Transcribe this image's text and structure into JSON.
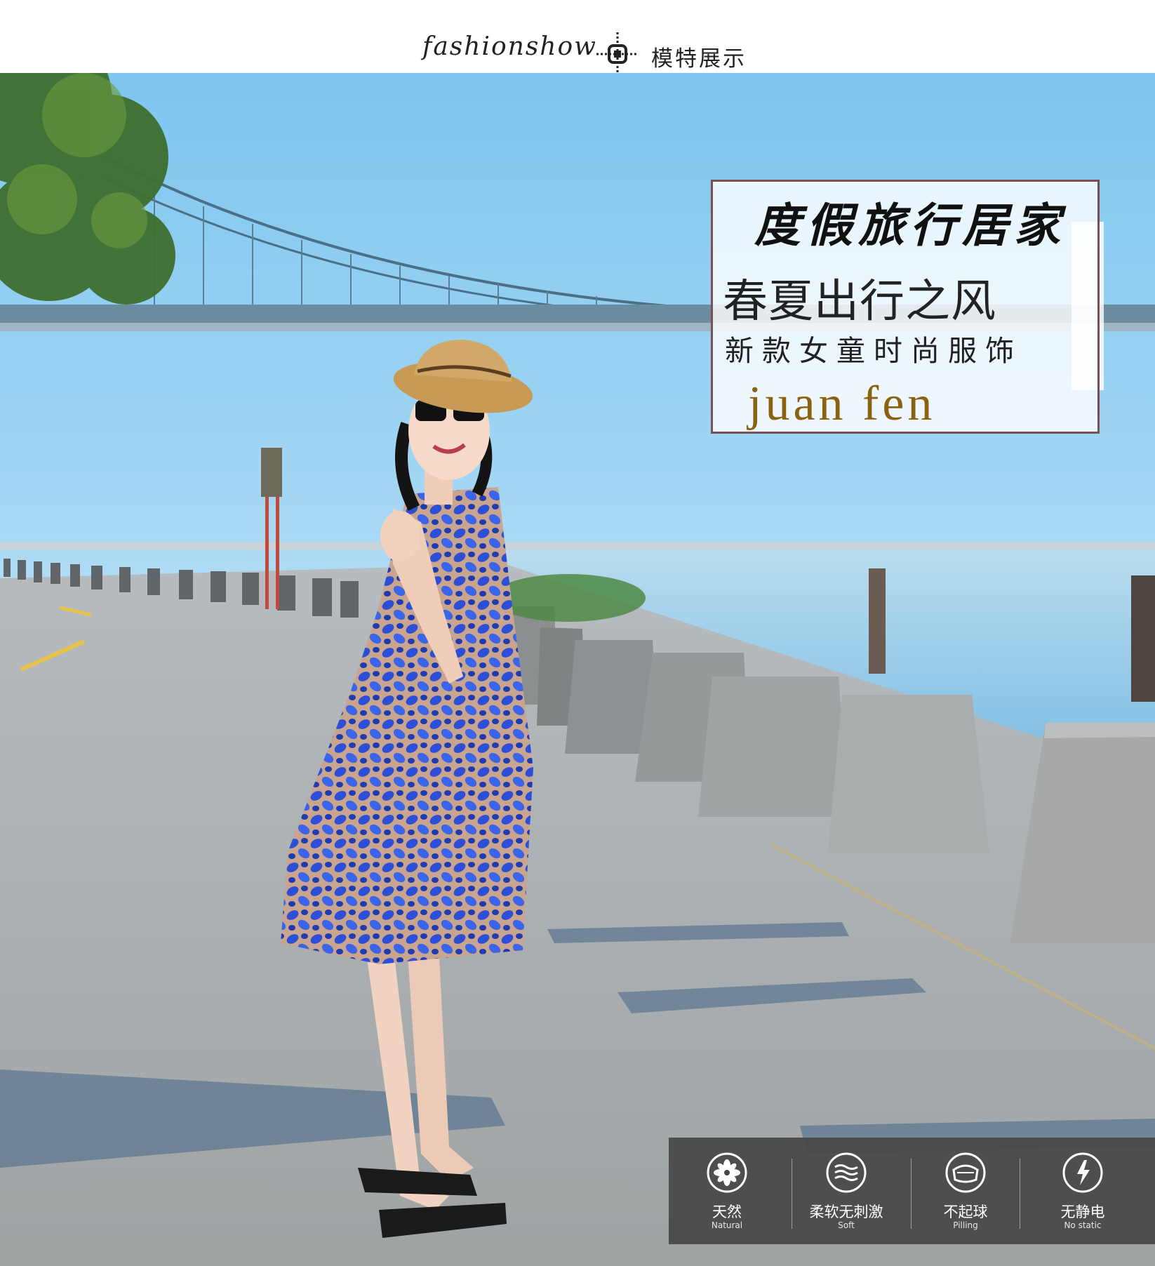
{
  "header": {
    "english_text": "fashionshow",
    "chinese_text": "模特展示"
  },
  "title_box": {
    "line1": "度假旅行居家",
    "line2": "春夏出行之风",
    "line3": "新款女童时尚服饰",
    "line4": "juan fen"
  },
  "features": [
    {
      "icon": "flower-icon",
      "label_cn": "天然",
      "label_en": "Natural"
    },
    {
      "icon": "wave-icon",
      "label_cn": "柔软无刺激",
      "label_en": "Soft"
    },
    {
      "icon": "pilling-icon",
      "label_cn": "不起球",
      "label_en": "Pilling"
    },
    {
      "icon": "lightning-icon",
      "label_cn": "无静电",
      "label_en": "No static"
    }
  ],
  "colors": {
    "frame_border": "#7a5055",
    "brand_gold": "#8a6210",
    "dress_blue": "#2f4fd6",
    "feature_bar": "#464646"
  }
}
